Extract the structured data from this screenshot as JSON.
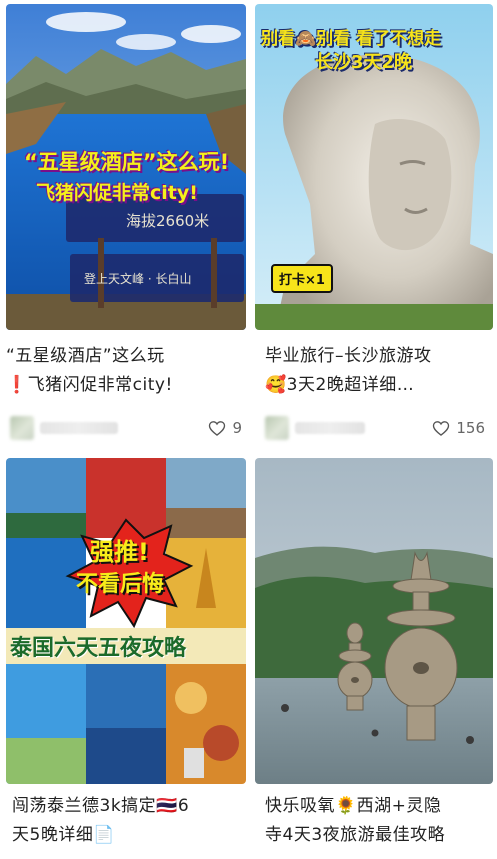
{
  "posts": [
    {
      "title_line1": "“五星级酒店”这么玩",
      "title_line2_emoji": "❗",
      "title_line2": "飞猪闪促非常city!",
      "likes": "9",
      "overlay": {
        "line1": "“五星级酒店”这么玩!",
        "line2": "飞猪闪促非常city!",
        "sign1": "海拔2660米",
        "sign2": "登上天文峰 ·  长白山"
      }
    },
    {
      "title_line1": "毕业旅行–长沙旅游攻",
      "title_line2_emoji": "🥰",
      "title_line2": "3天2晚超详细…",
      "likes": "156",
      "overlay": {
        "line1": "别看🙈别看 看了不想走",
        "line2": "长沙3天2晚",
        "badge": "打卡×1"
      }
    },
    {
      "title_line1": "闯荡泰兰德3k搞定🇹🇭6",
      "title_line2": "天5晚详细📄",
      "overlay": {
        "burst1": "强推!",
        "burst2": "不看后悔",
        "banner": "泰国六天五夜攻略"
      }
    },
    {
      "title_line1": "快乐吸氧🌻西湖+灵隐",
      "title_line2": "寺4天3夜旅游最佳攻略"
    }
  ],
  "icons": {
    "like": "heart-outline-icon"
  },
  "colors": {
    "text": "#222222",
    "muted": "#666666"
  }
}
